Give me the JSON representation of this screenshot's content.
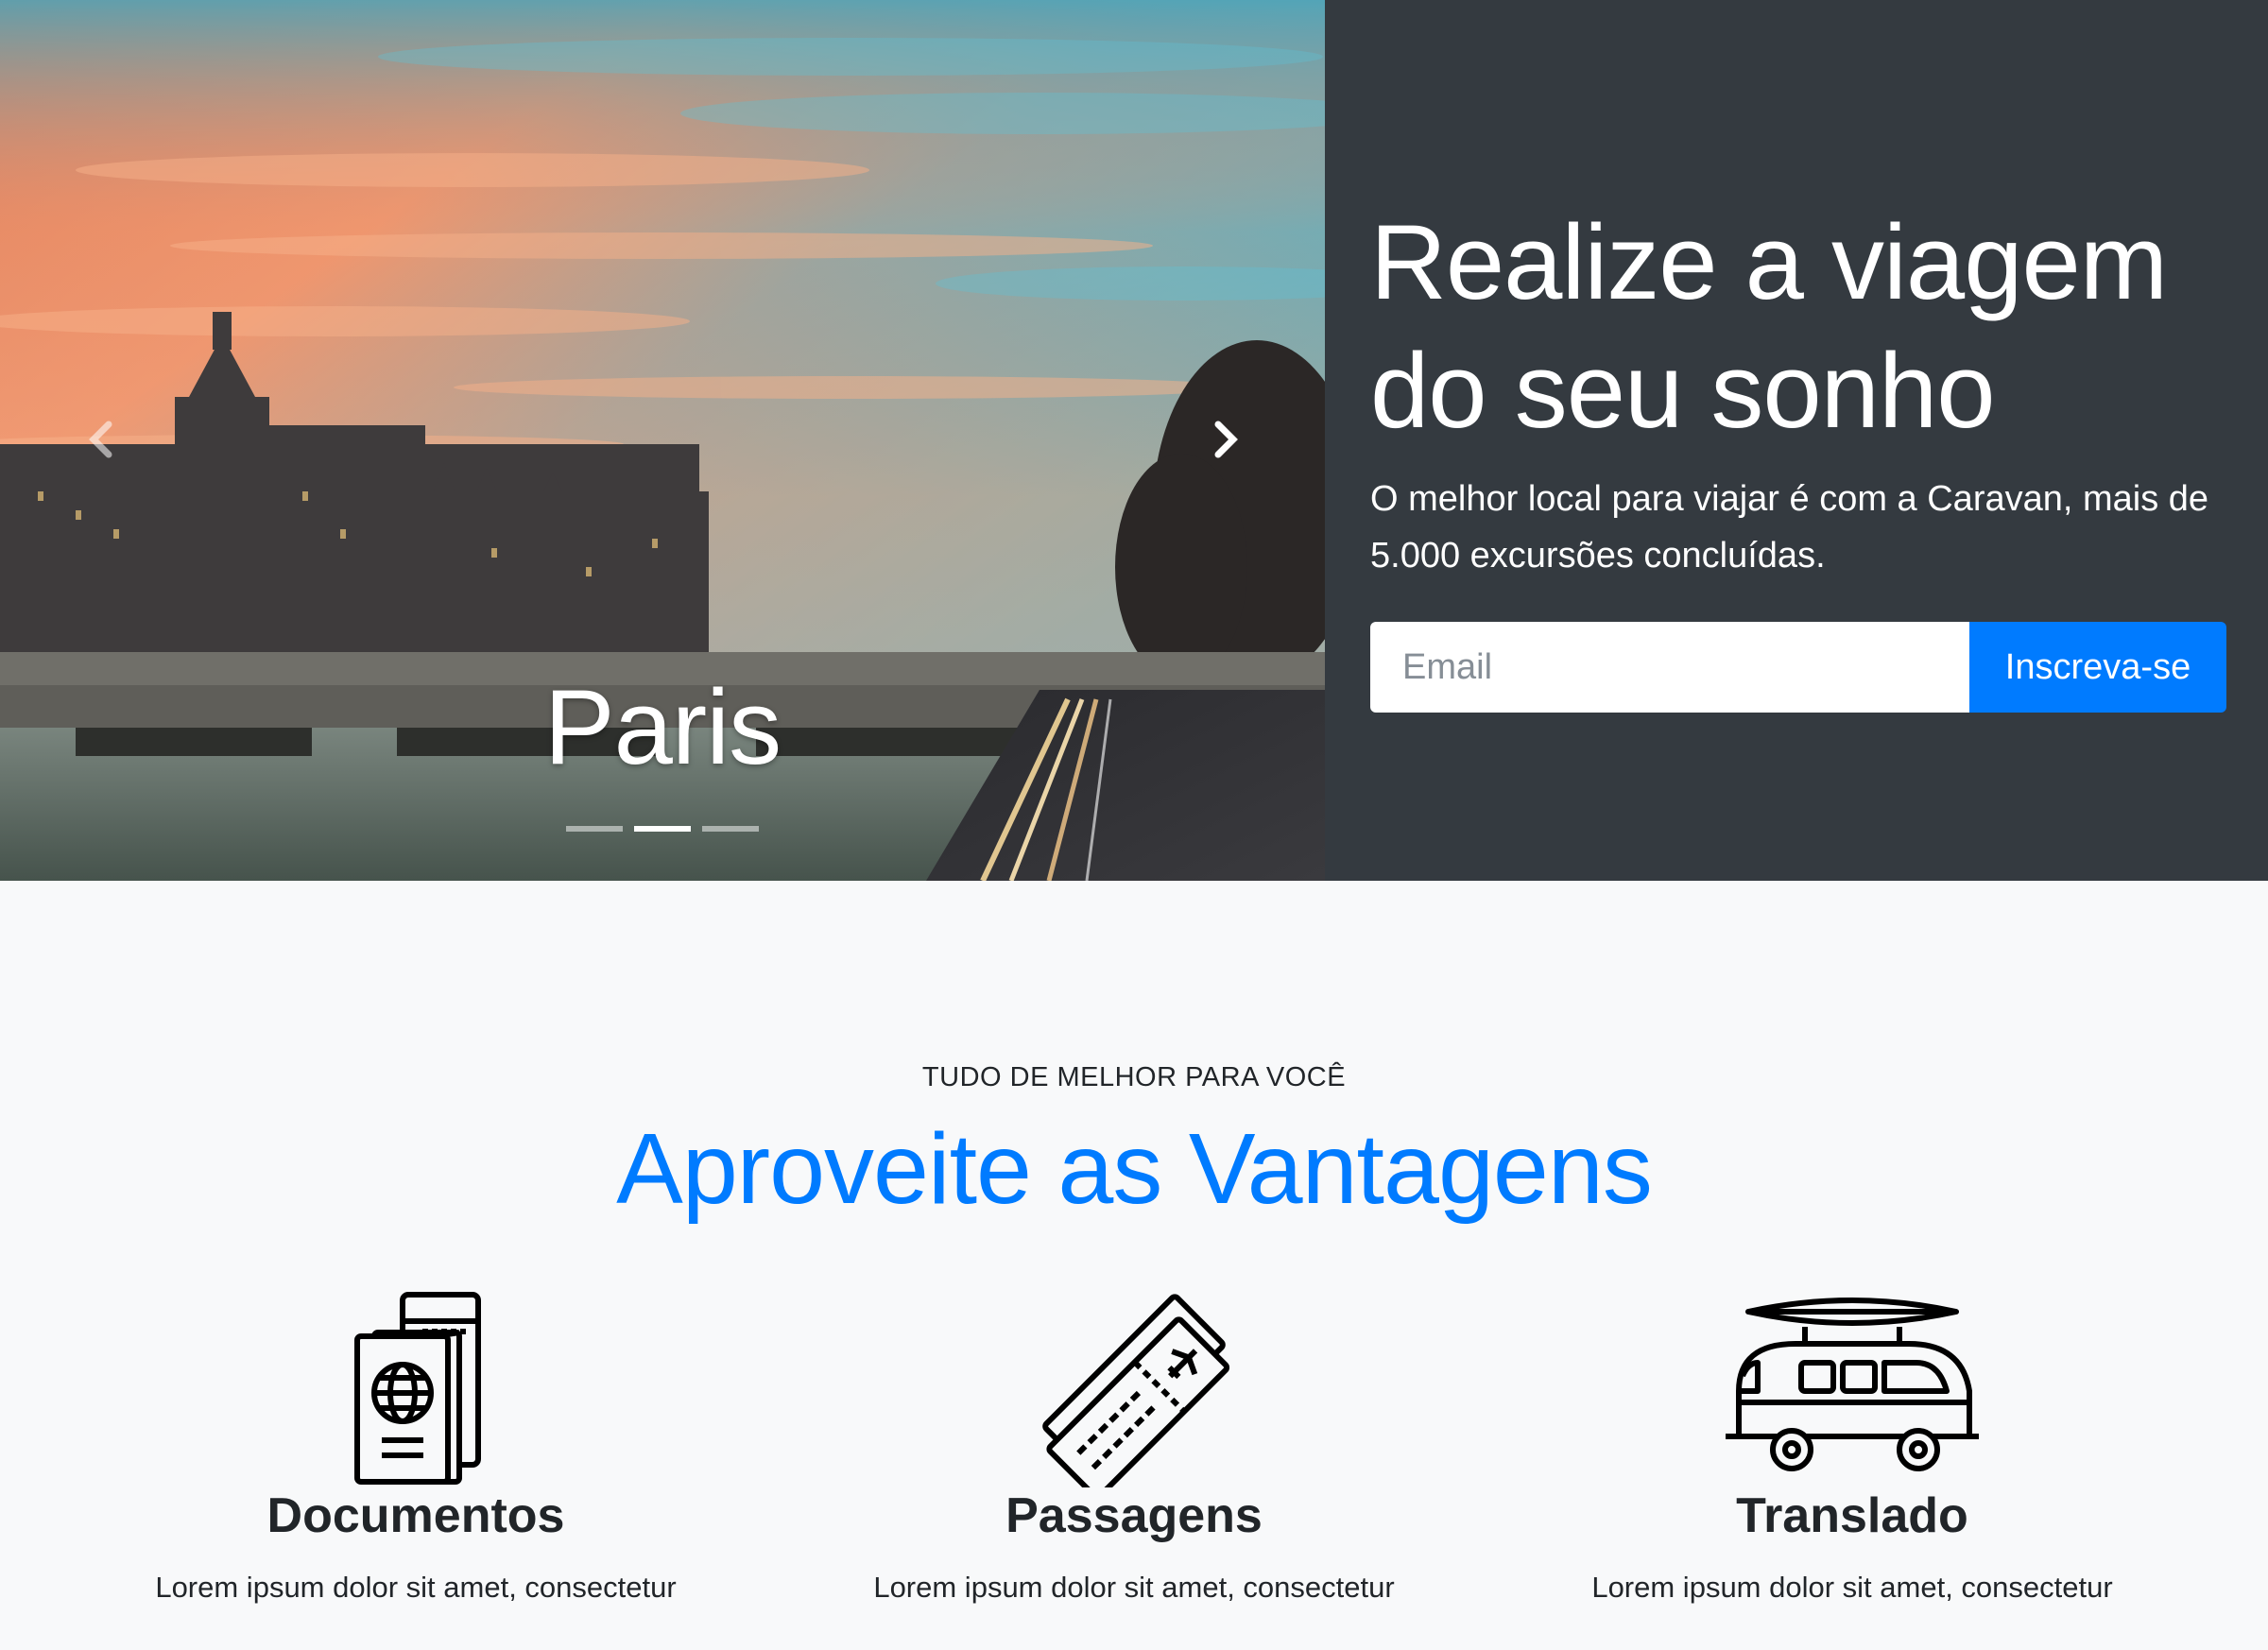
{
  "carousel": {
    "caption": "Paris",
    "slide_count": 3,
    "active_slide": 2,
    "prev_icon": "chevron-left-icon",
    "next_icon": "chevron-right-icon"
  },
  "promo": {
    "title": "Realize a viagem do seu sonho",
    "description": "O melhor local para viajar é com a Caravan, mais de 5.000 excursões concluídas.",
    "email_placeholder": "Email",
    "signup_label": "Inscreva-se"
  },
  "features": {
    "eyebrow": "TUDO DE MELHOR PARA VOCÊ",
    "heading": "Aproveite as Vantagens",
    "items": [
      {
        "icon": "passport-icon",
        "title": "Documentos",
        "text": "Lorem ipsum dolor sit amet, consectetur"
      },
      {
        "icon": "plane-tickets-icon",
        "title": "Passagens",
        "text": "Lorem ipsum dolor sit amet, consectetur"
      },
      {
        "icon": "van-icon",
        "title": "Translado",
        "text": "Lorem ipsum dolor sit amet, consectetur"
      }
    ]
  },
  "colors": {
    "primary": "#007bff",
    "dark_panel": "#343a40",
    "page_bg": "#f8f9fa"
  }
}
